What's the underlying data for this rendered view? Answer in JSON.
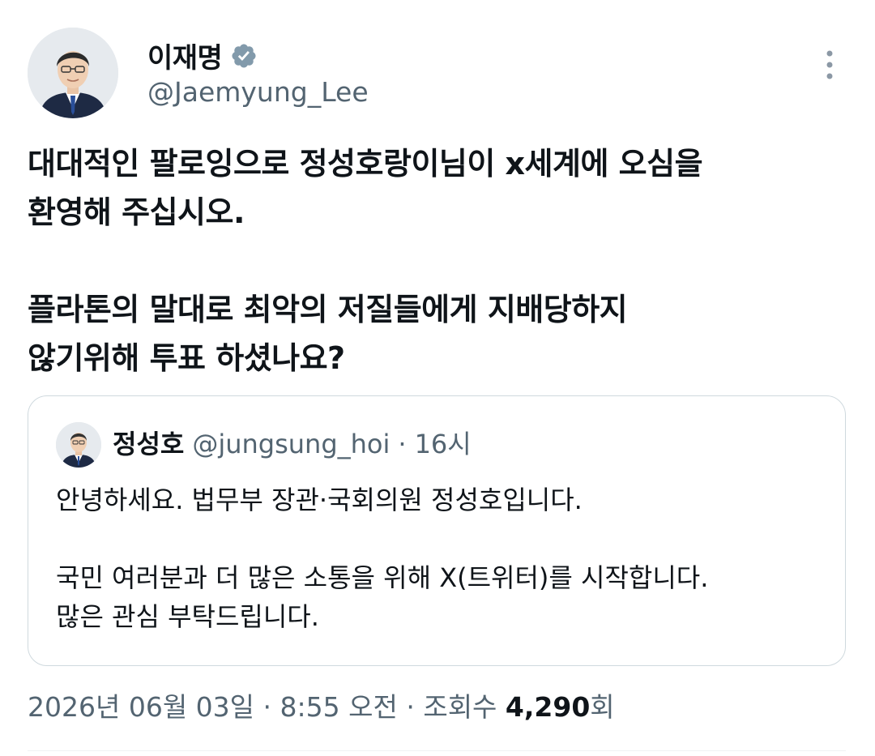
{
  "author": {
    "name": "이재명",
    "handle": "@Jaemyung_Lee",
    "verified_icon": "verified-badge-icon",
    "avatar_icon": "profile-photo"
  },
  "menu_icon": "more-options-icon",
  "tweet": {
    "lines": [
      "대대적인 팔로잉으로 정성호랑이님이 x세계에 오심을",
      "환영해 주십시오.",
      "플라톤의 말대로 최악의 저질들에게 지배당하지",
      "않기위해 투표 하셨나요?"
    ]
  },
  "quoted": {
    "name": "정성호",
    "handle": "@jungsung_hoi",
    "separator": "·",
    "time": "16시",
    "lines": [
      "안녕하세요. 법무부 장관·국회의원 정성호입니다.",
      "국민 여러분과 더 많은 소통을 위해 X(트위터)를 시작합니다.",
      "많은 관심 부탁드립니다."
    ]
  },
  "meta": {
    "date": "2026년 06월 03일",
    "sep1": " · ",
    "time": "8:55 오전",
    "sep2": " · ",
    "views_label": "조회수 ",
    "views_count": "4,290",
    "views_suffix": "회"
  },
  "colors": {
    "verified": "#829aab",
    "secondary_text": "#536471",
    "border": "#cfd9de"
  }
}
